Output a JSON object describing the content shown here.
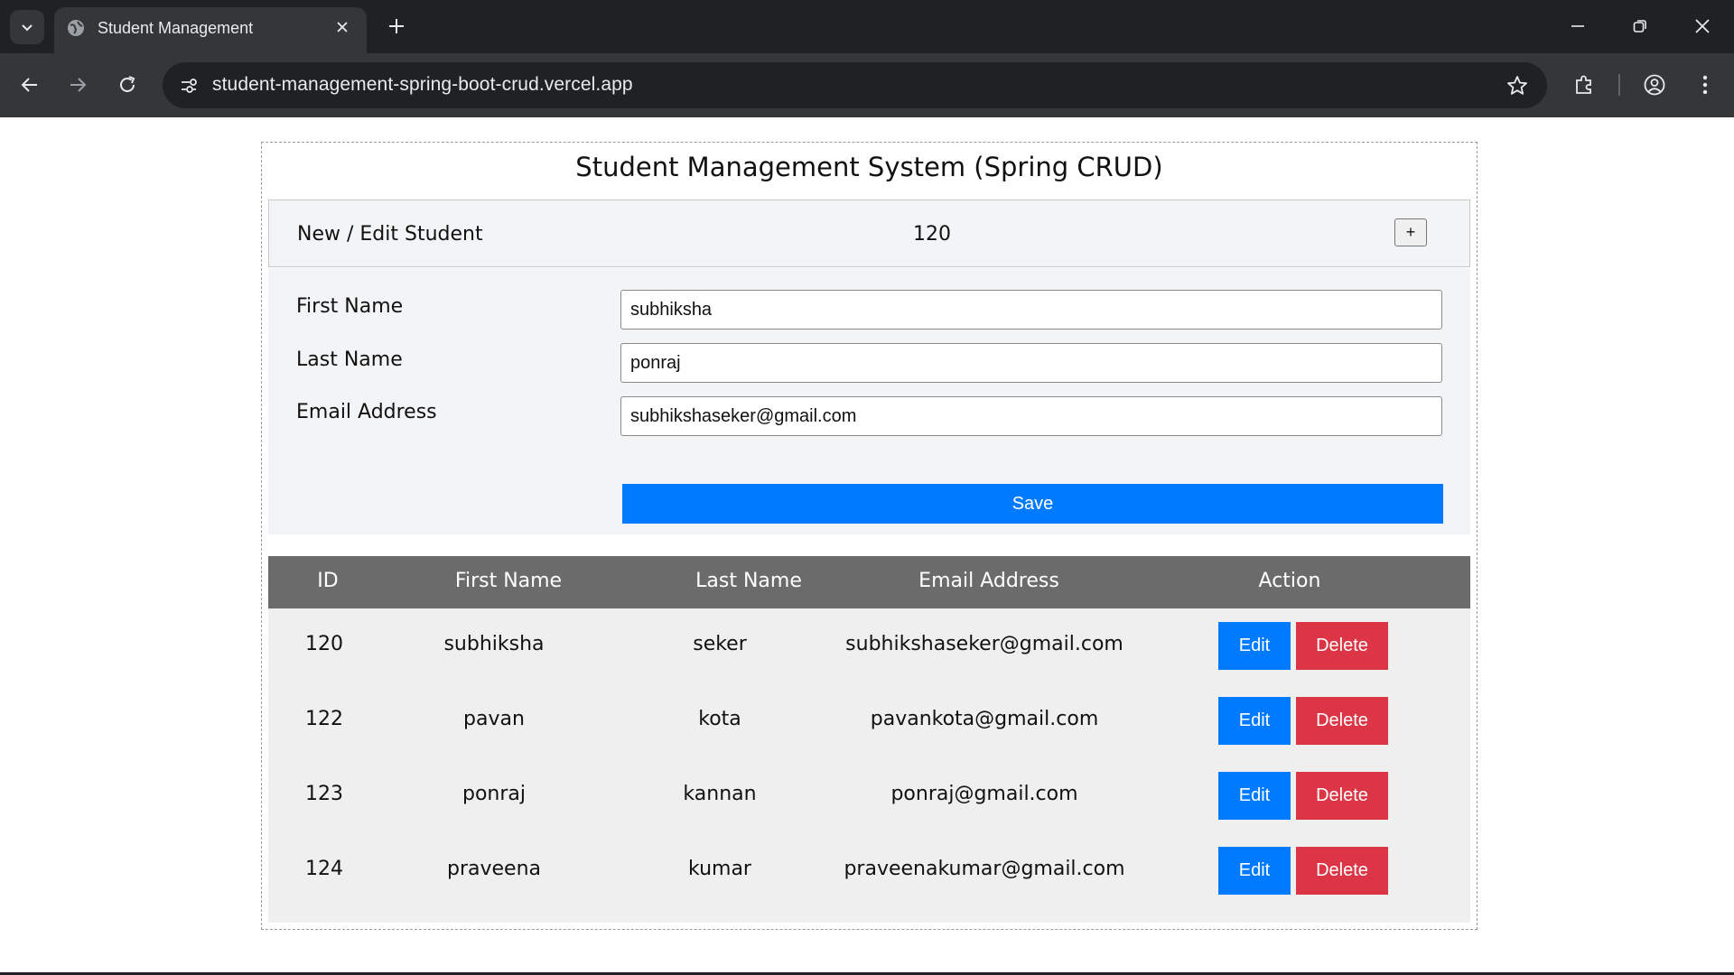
{
  "browser": {
    "tab_title": "Student Management",
    "url": "student-management-spring-boot-crud.vercel.app",
    "icons": [
      "tab-list-icon",
      "globe-icon",
      "close-icon",
      "plus-icon",
      "minimize-icon",
      "restore-icon",
      "window-close-icon",
      "back-icon",
      "forward-icon",
      "reload-icon",
      "site-info-icon",
      "star-icon",
      "extensions-icon",
      "profile-icon",
      "menu-icon"
    ]
  },
  "page": {
    "title": "Student Management System (Spring CRUD)"
  },
  "form": {
    "header_label": "New / Edit Student",
    "current_id": "120",
    "add_button": "+",
    "fields": {
      "first_name": {
        "label": "First Name",
        "value": "subhiksha"
      },
      "last_name": {
        "label": "Last Name",
        "value": "ponraj"
      },
      "email": {
        "label": "Email Address",
        "value": "subhikshaseker@gmail.com"
      }
    },
    "save_label": "Save"
  },
  "table": {
    "headers": {
      "id": "ID",
      "first_name": "First Name",
      "last_name": "Last Name",
      "email": "Email Address",
      "action": "Action"
    },
    "rows": [
      {
        "id": "120",
        "first_name": "subhiksha",
        "last_name": "seker",
        "email": "subhikshaseker@gmail.com",
        "edit": "Edit",
        "delete": "Delete"
      },
      {
        "id": "122",
        "first_name": "pavan",
        "last_name": "kota",
        "email": "pavankota@gmail.com",
        "edit": "Edit",
        "delete": "Delete"
      },
      {
        "id": "123",
        "first_name": "ponraj",
        "last_name": "kannan",
        "email": "ponraj@gmail.com",
        "edit": "Edit",
        "delete": "Delete"
      },
      {
        "id": "124",
        "first_name": "praveena",
        "last_name": "kumar",
        "email": "praveenakumar@gmail.com",
        "edit": "Edit",
        "delete": "Delete"
      }
    ]
  },
  "colors": {
    "primary": "#007bff",
    "danger": "#dc3545",
    "table_header": "#6b6b6b",
    "chrome_dark": "#202124",
    "chrome_toolbar": "#35363a"
  }
}
